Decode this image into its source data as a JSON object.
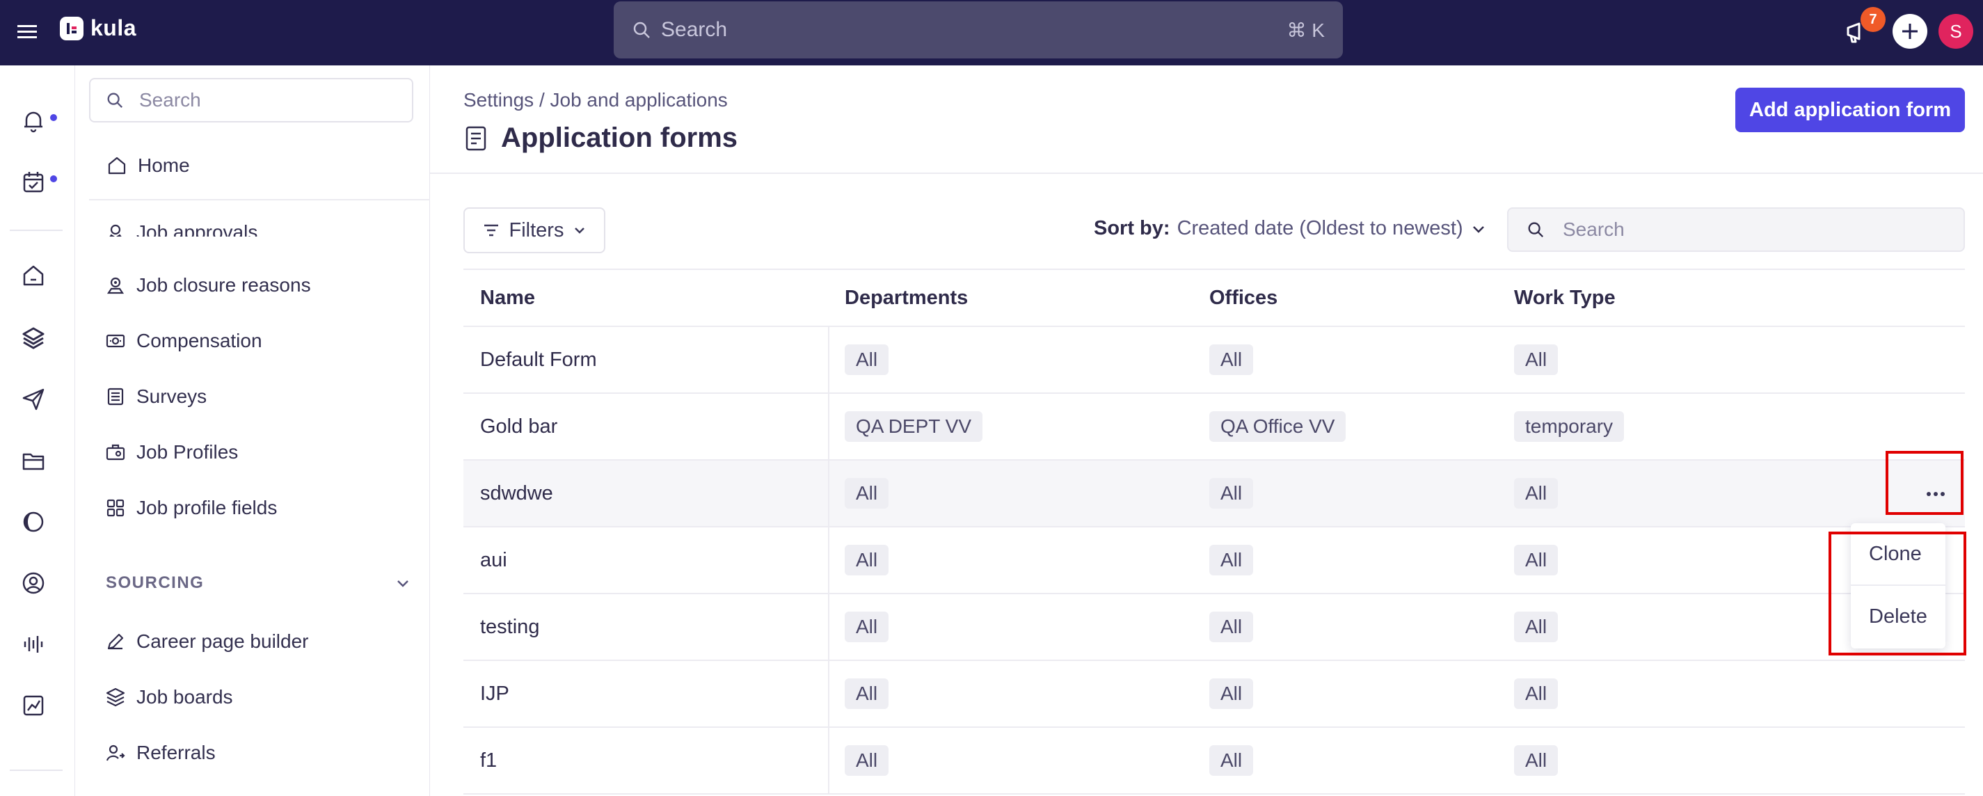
{
  "topbar": {
    "app_name": "kula",
    "search_placeholder": "Search",
    "shortcut": "⌘ K",
    "notifications_count": "7",
    "avatar_initial": "S"
  },
  "nav": {
    "search_placeholder": "Search",
    "home": "Home",
    "items": [
      {
        "label": "Job approvals",
        "icon": "approvals-icon"
      },
      {
        "label": "Job closure reasons",
        "icon": "closure-icon"
      },
      {
        "label": "Compensation",
        "icon": "money-icon"
      },
      {
        "label": "Surveys",
        "icon": "survey-icon"
      },
      {
        "label": "Job Profiles",
        "icon": "briefcase-icon"
      },
      {
        "label": "Job profile fields",
        "icon": "grid-icon"
      }
    ],
    "section": "SOURCING",
    "sourcing_items": [
      {
        "label": "Career page builder",
        "icon": "pen-icon"
      },
      {
        "label": "Job boards",
        "icon": "layers-icon"
      },
      {
        "label": "Referrals",
        "icon": "referral-icon"
      }
    ]
  },
  "main": {
    "breadcrumb": "Settings / Job and applications",
    "title": "Application forms",
    "add_button": "Add application form",
    "filters_label": "Filters",
    "sort_label": "Sort by:",
    "sort_value": "Created date (Oldest to newest)",
    "search_placeholder": "Search"
  },
  "table": {
    "headers": [
      "Name",
      "Departments",
      "Offices",
      "Work Type"
    ],
    "rows": [
      {
        "name": "Default Form",
        "departments": "All",
        "offices": "All",
        "work_type": "All"
      },
      {
        "name": "Gold bar",
        "departments": "QA DEPT VV",
        "offices": "QA Office VV",
        "work_type": "temporary"
      },
      {
        "name": "sdwdwe",
        "departments": "All",
        "offices": "All",
        "work_type": "All"
      },
      {
        "name": "aui",
        "departments": "All",
        "offices": "All",
        "work_type": "All"
      },
      {
        "name": "testing",
        "departments": "All",
        "offices": "All",
        "work_type": "All"
      },
      {
        "name": "IJP",
        "departments": "All",
        "offices": "All",
        "work_type": "All"
      },
      {
        "name": "f1",
        "departments": "All",
        "offices": "All",
        "work_type": "All"
      }
    ]
  },
  "row_menu": {
    "clone": "Clone",
    "delete": "Delete"
  },
  "colors": {
    "topbar": "#1e1b4b",
    "accent": "#4f46e5",
    "highlight": "#e00000"
  }
}
